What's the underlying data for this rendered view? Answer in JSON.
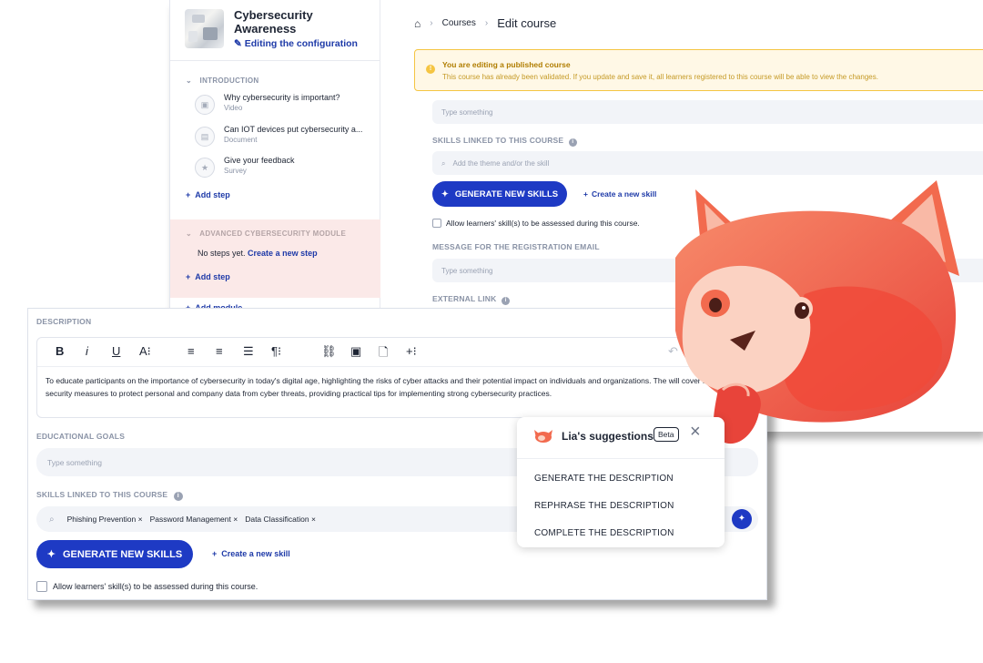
{
  "colors": {
    "brand_blue": "#1e3ac4",
    "link_blue": "#1e3aa8",
    "warning_yellow": "#f5c542",
    "module_highlight": "#fbe9e8",
    "mascot_red": "#f0533b"
  },
  "sidebar": {
    "course_title": "Cybersecurity Awareness",
    "edit_label": "Editing the configuration",
    "modules": [
      {
        "title": "INTRODUCTION",
        "steps": [
          {
            "title": "Why cybersecurity is important?",
            "type": "Video",
            "icon": "video-icon"
          },
          {
            "title": "Can IOT devices put cybersecurity a...",
            "type": "Document",
            "icon": "document-icon"
          },
          {
            "title": "Give your feedback",
            "type": "Survey",
            "icon": "star-icon"
          }
        ],
        "add_step": "Add step"
      },
      {
        "title": "ADVANCED CYBERSECURITY MODULE",
        "empty_text": "No steps yet.",
        "create_link": "Create a new step",
        "add_step": "Add step"
      }
    ],
    "add_module": "Add module"
  },
  "breadcrumb": {
    "courses": "Courses",
    "current": "Edit course"
  },
  "warning": {
    "title": "You are editing a published course",
    "text": "This course has already been validated. If you update and save it, all learners registered to this course will be able to view the changes."
  },
  "back_form": {
    "goals_placeholder": "Type something",
    "skills_label": "SKILLS LINKED TO THIS COURSE",
    "skills_placeholder": "Add the theme and/or the skill",
    "generate_label": "GENERATE NEW SKILLS",
    "create_skill": "Create a new skill",
    "assess_label": "Allow learners' skill(s) to be assessed during this course.",
    "email_label": "MESSAGE FOR THE REGISTRATION EMAIL",
    "email_placeholder": "Type something",
    "external_label": "EXTERNAL LINK"
  },
  "front_form": {
    "description_label": "DESCRIPTION",
    "toolbar": [
      "B",
      "i",
      "U",
      "A⁝",
      "≡",
      "≡",
      "☰",
      "¶⁝",
      "⛓",
      "▣",
      "🗋",
      "+⁝",
      "↶"
    ],
    "description_text": "To educate participants on the importance of cybersecurity in today's digital age, highlighting the risks of cyber attacks and their potential impact on individuals and organizations. The will cover basic security measures to protect personal and company data from cyber threats, providing practical tips for implementing strong cybersecurity practices.",
    "goals_label": "EDUCATIONAL GOALS",
    "goals_placeholder": "Type something",
    "skills_label": "SKILLS LINKED TO THIS COURSE",
    "skills": [
      "Phishing Prevention",
      "Password Management",
      "Data Classification"
    ],
    "generate_label": "GENERATE NEW SKILLS",
    "create_skill": "Create a new skill",
    "assess_label": "Allow learners' skill(s) to be assessed during this course."
  },
  "suggestions": {
    "title": "Lia's suggestions",
    "badge": "Beta",
    "items": [
      "GENERATE THE DESCRIPTION",
      "REPHRASE THE DESCRIPTION",
      "COMPLETE THE DESCRIPTION"
    ]
  }
}
